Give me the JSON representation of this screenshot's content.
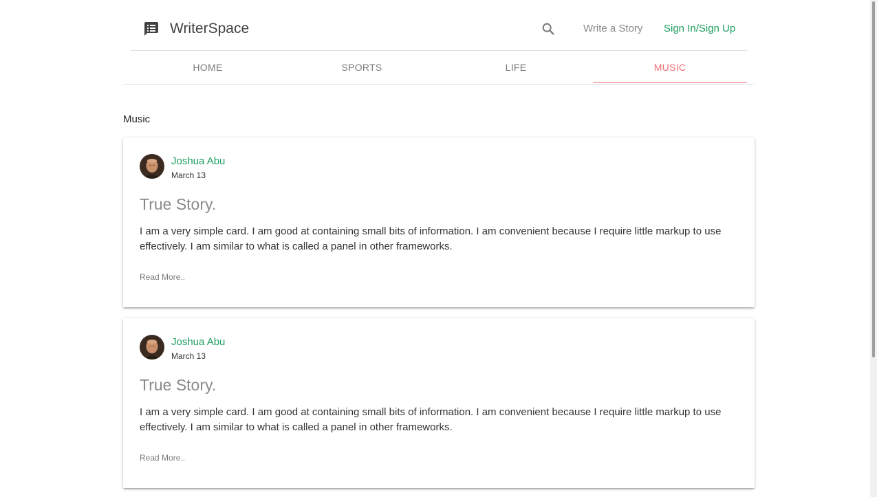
{
  "header": {
    "brand_name": "WriterSpace",
    "brand_icon": "chat-icon",
    "search_icon": "search-icon",
    "write_link": "Write a Story",
    "signin_link": "Sign In/Sign Up",
    "accent_color": "#1e9e5e"
  },
  "tabs": [
    {
      "label": "HOME",
      "active": false
    },
    {
      "label": "SPORTS",
      "active": false
    },
    {
      "label": "LIFE",
      "active": false
    },
    {
      "label": "MUSIC",
      "active": true
    }
  ],
  "active_tab_color": "#ee6e73",
  "section": {
    "title": "Music"
  },
  "posts": [
    {
      "author": "Joshua Abu",
      "date": "March 13",
      "title": "True Story.",
      "body": "I am a very simple card. I am good at containing small bits of information. I am convenient because I require little markup to use effectively. I am similar to what is called a panel in other frameworks.",
      "read_more": "Read More.."
    },
    {
      "author": "Joshua Abu",
      "date": "March 13",
      "title": "True Story.",
      "body": "I am a very simple card. I am good at containing small bits of information. I am convenient because I require little markup to use effectively. I am similar to what is called a panel in other frameworks.",
      "read_more": "Read More.."
    }
  ]
}
